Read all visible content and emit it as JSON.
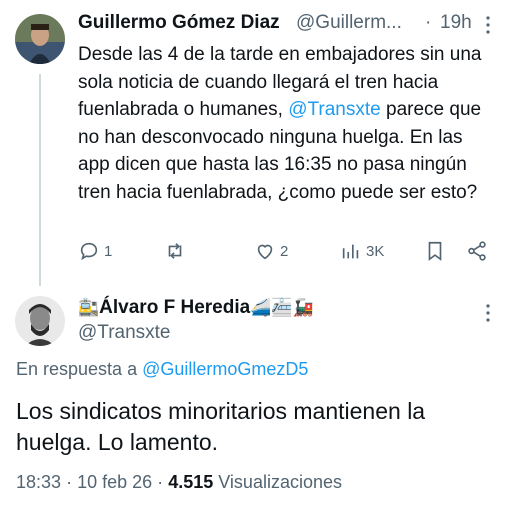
{
  "tweet1": {
    "name": "Guillermo Gómez Diaz",
    "handle": "@Guillerm...",
    "separator": "·",
    "time": "19h",
    "text_before": "Desde las 4 de la tarde en embajadores sin una sola noticia de cuando llegará el tren hacia fuenlabrada o humanes, ",
    "mention": "@Transxte",
    "text_after": " parece que no han desconvocado ninguna huelga. En las app dicen que hasta las 16:35 no pasa ningún tren hacia fuenlabrada, ¿como puede ser esto?",
    "stats": {
      "replies": "1",
      "retweets": "",
      "likes": "2",
      "views": "3K"
    }
  },
  "tweet2": {
    "name_prefix_emoji": "🚉",
    "name": "Álvaro F Heredia",
    "name_suffix_emoji": "🚄🚈🚂",
    "handle": "@Transxte",
    "reply_prefix": "En respuesta a ",
    "reply_mention": "@GuillermoGmezD5",
    "text": "Los sindicatos minoritarios mantienen la huelga. Lo lamento.",
    "time": "18:33",
    "date": "10 feb 26",
    "sep": "·",
    "views_count": "4.515",
    "views_label": "Visualizaciones"
  },
  "colors": {
    "accent": "#1d9bf0",
    "secondary": "#536471",
    "primary": "#0f1419",
    "line": "#cfd9de"
  }
}
